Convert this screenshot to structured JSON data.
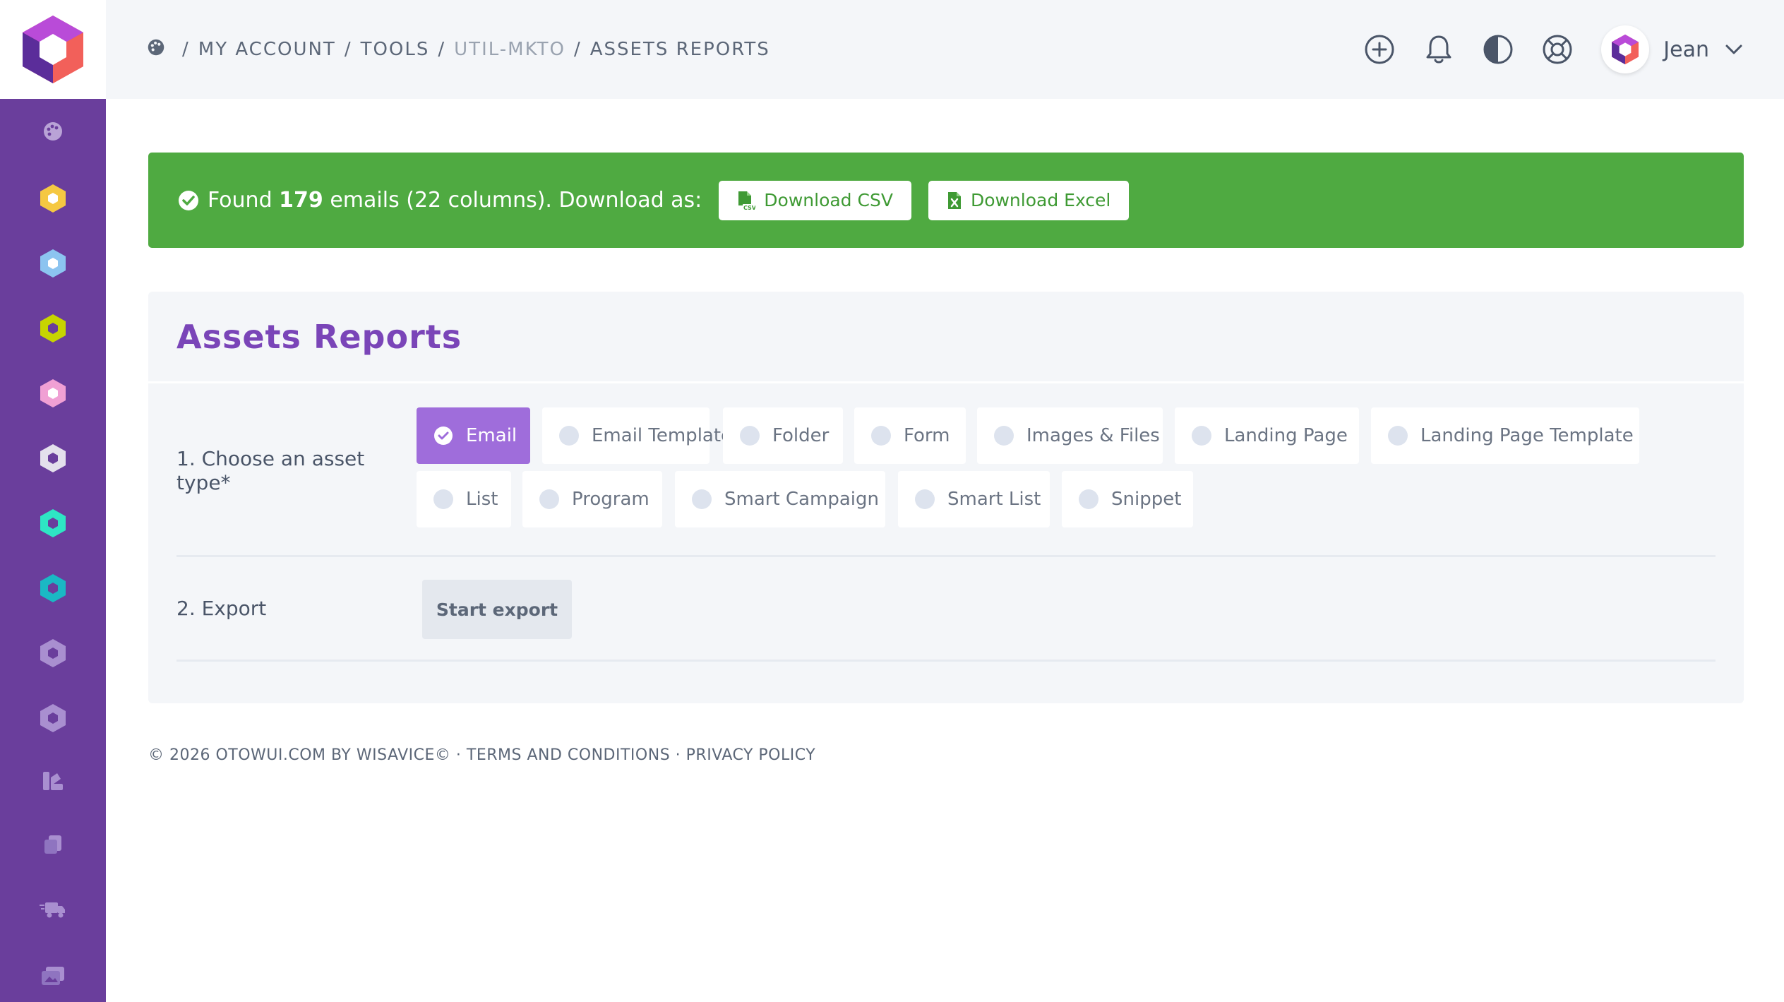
{
  "breadcrumb": {
    "home_icon": "palette-icon",
    "items": [
      "MY ACCOUNT",
      "TOOLS",
      "UTIL-MKTO",
      "ASSETS REPORTS"
    ],
    "separator": "/"
  },
  "sidebar": {
    "items": [
      {
        "icon": "palette-icon",
        "color": "#b9a3d6"
      },
      {
        "icon": "hexagon-icon",
        "color": "#f5c842"
      },
      {
        "icon": "hexagon-icon",
        "color": "#8cc4f0"
      },
      {
        "icon": "hexagon-icon",
        "color": "#c7d400"
      },
      {
        "icon": "hexagon-icon",
        "color": "#f0a0d4"
      },
      {
        "icon": "hexagon-icon",
        "color": "#e4e0ec"
      },
      {
        "icon": "hexagon-icon",
        "color": "#2ee6c4"
      },
      {
        "icon": "hexagon-icon",
        "color": "#1ab8c4"
      },
      {
        "icon": "hexagon-icon",
        "color": "#a98fd0"
      },
      {
        "icon": "hexagon-icon",
        "color": "#a98fd0"
      },
      {
        "icon": "swatch-book-icon",
        "color": "#a98fd0"
      },
      {
        "icon": "copy-icon",
        "color": "#a98fd0"
      },
      {
        "icon": "shipping-fast-icon",
        "color": "#a98fd0"
      },
      {
        "icon": "images-icon",
        "color": "#a98fd0"
      }
    ]
  },
  "topbar": {
    "icons": [
      "plus-circle-icon",
      "bell-icon",
      "contrast-icon",
      "life-ring-icon"
    ],
    "user_name": "Jean"
  },
  "alert": {
    "text_before": "Found",
    "count": "179",
    "text_after": "emails (22 columns). Download as:",
    "csv_label": "Download CSV",
    "excel_label": "Download Excel",
    "color": "#4faa41"
  },
  "card": {
    "title": "Assets Reports",
    "step1_label": "1. Choose an asset type*",
    "step2_label": "2. Export",
    "start_export_label": "Start export",
    "asset_types": [
      {
        "label": "Email",
        "selected": true
      },
      {
        "label": "Email Template",
        "selected": false
      },
      {
        "label": "Folder",
        "selected": false
      },
      {
        "label": "Form",
        "selected": false
      },
      {
        "label": "Images & Files",
        "selected": false
      },
      {
        "label": "Landing Page",
        "selected": false
      },
      {
        "label": "Landing Page Template",
        "selected": false
      },
      {
        "label": "List",
        "selected": false
      },
      {
        "label": "Program",
        "selected": false
      },
      {
        "label": "Smart Campaign",
        "selected": false
      },
      {
        "label": "Smart List",
        "selected": false
      },
      {
        "label": "Snippet",
        "selected": false
      }
    ],
    "accent_color": "#9f6ddb"
  },
  "footer": {
    "copyright": "© 2026 OTOWUI.COM BY WISAVICE©",
    "dot": "·",
    "terms": "TERMS AND CONDITIONS",
    "privacy": "PRIVACY POLICY"
  }
}
